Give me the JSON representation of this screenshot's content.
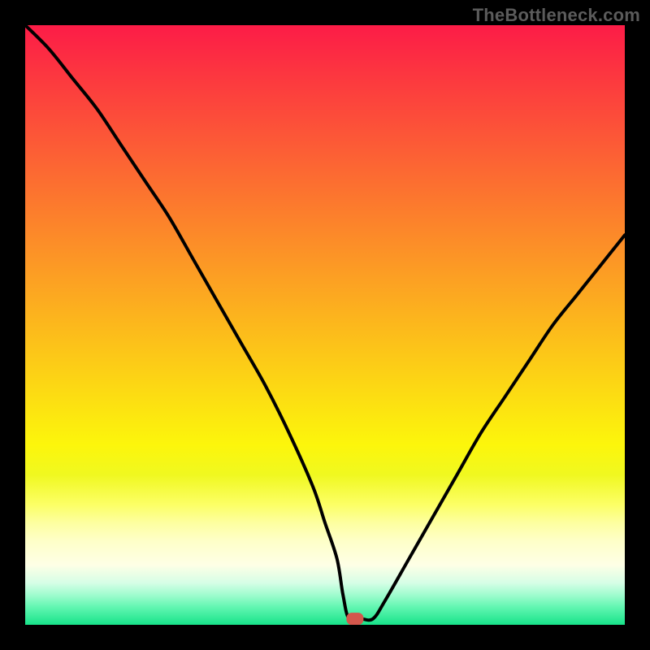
{
  "watermark": "TheBottleneck.com",
  "chart_data": {
    "type": "line",
    "title": "",
    "xlabel": "",
    "ylabel": "",
    "xlim": [
      0,
      100
    ],
    "ylim": [
      0,
      100
    ],
    "grid": false,
    "legend": false,
    "background_gradient": {
      "direction": "vertical",
      "stops": [
        {
          "pos": 0,
          "color": "#FC1C47"
        },
        {
          "pos": 10,
          "color": "#FC3C3E"
        },
        {
          "pos": 20,
          "color": "#FC5B36"
        },
        {
          "pos": 30,
          "color": "#FC7A2D"
        },
        {
          "pos": 40,
          "color": "#FC9925"
        },
        {
          "pos": 50,
          "color": "#FCB81C"
        },
        {
          "pos": 60,
          "color": "#FCD714"
        },
        {
          "pos": 70,
          "color": "#FCF60B"
        },
        {
          "pos": 75,
          "color": "#F0F820"
        },
        {
          "pos": 80,
          "color": "#FCFF66"
        },
        {
          "pos": 83,
          "color": "#FDFFA0"
        },
        {
          "pos": 86,
          "color": "#FEFFC8"
        },
        {
          "pos": 90,
          "color": "#FEFFE6"
        },
        {
          "pos": 93,
          "color": "#D6FEE6"
        },
        {
          "pos": 95,
          "color": "#A0FCCF"
        },
        {
          "pos": 97,
          "color": "#63F6B2"
        },
        {
          "pos": 100,
          "color": "#17E389"
        }
      ]
    },
    "series": [
      {
        "name": "bottleneck-curve",
        "color": "#000000",
        "x": [
          0,
          4,
          8,
          12,
          16,
          20,
          24,
          28,
          32,
          36,
          40,
          44,
          48,
          50,
          52,
          53,
          54,
          56,
          58,
          60,
          64,
          68,
          72,
          76,
          80,
          84,
          88,
          92,
          96,
          100
        ],
        "y": [
          100,
          96,
          91,
          86,
          80,
          74,
          68,
          61,
          54,
          47,
          40,
          32,
          23,
          17,
          11,
          5,
          1,
          1,
          1,
          4,
          11,
          18,
          25,
          32,
          38,
          44,
          50,
          55,
          60,
          65
        ]
      }
    ],
    "marker": {
      "name": "result-marker",
      "x": 55,
      "y": 1,
      "color": "#D4574C",
      "shape": "rounded-rect"
    }
  }
}
